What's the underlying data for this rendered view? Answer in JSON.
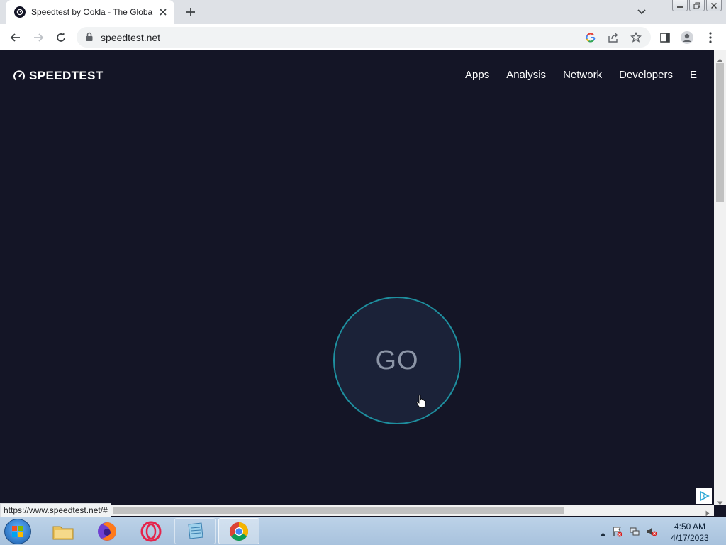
{
  "browser": {
    "tab": {
      "title": "Speedtest by Ookla - The Global"
    },
    "address": {
      "url": "speedtest.net"
    },
    "status_url": "https://www.speedtest.net/#"
  },
  "site": {
    "logo_text": "SPEEDTEST",
    "nav": [
      "Apps",
      "Analysis",
      "Network",
      "Developers",
      "E"
    ],
    "go_label": "GO"
  },
  "taskbar": {
    "time": "4:50 AM",
    "date": "4/17/2023"
  },
  "colors": {
    "page_bg": "#141526",
    "go_ring": "#1e8f9f",
    "go_text": "#8c95a6"
  }
}
